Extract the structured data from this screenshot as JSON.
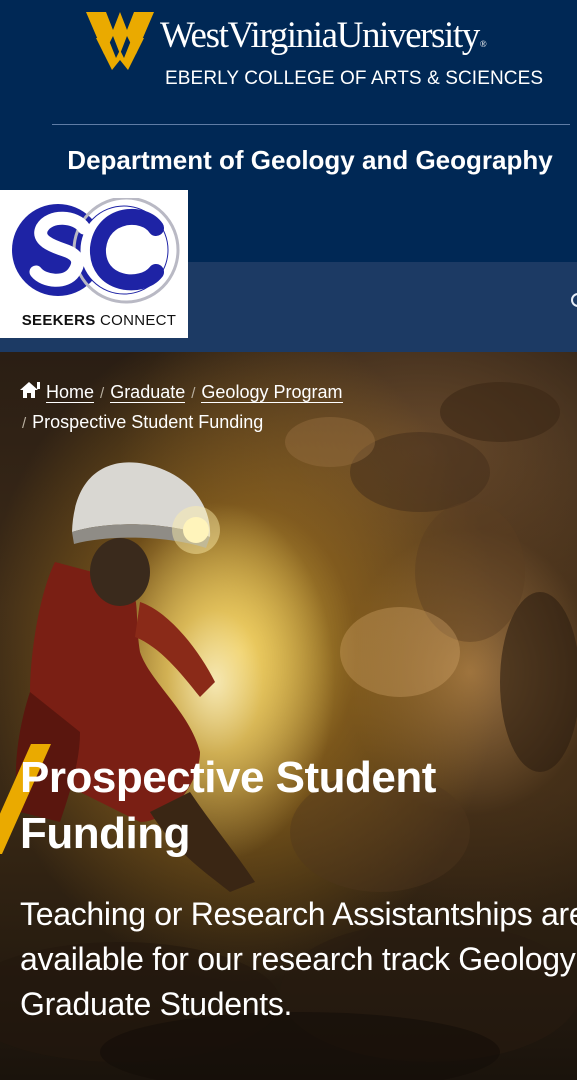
{
  "header": {
    "university": "WestVirginiaUniversity",
    "college": "EBERLY COLLEGE OF ARTS & SCIENCES",
    "department": "Department of Geology and Geography"
  },
  "badge": {
    "brand_bold": "SEEKERS",
    "brand_rest": " CONNECT"
  },
  "breadcrumb": {
    "items": [
      {
        "label": "Home"
      },
      {
        "label": "Graduate"
      },
      {
        "label": "Geology Program"
      }
    ],
    "current": "Prospective Student Funding"
  },
  "hero": {
    "title": "Prospective Student Funding",
    "subtitle": "Teaching or Research Assistantships are available for our research track Geology Graduate Students."
  },
  "colors": {
    "navy": "#002855",
    "gold": "#EAAA00",
    "nav_strip": "#1C3A64",
    "badge_blue": "#1E23A5"
  },
  "icons": [
    "wv-flying-wv-logo",
    "search-icon",
    "home-icon",
    "seekers-connect-logo"
  ]
}
